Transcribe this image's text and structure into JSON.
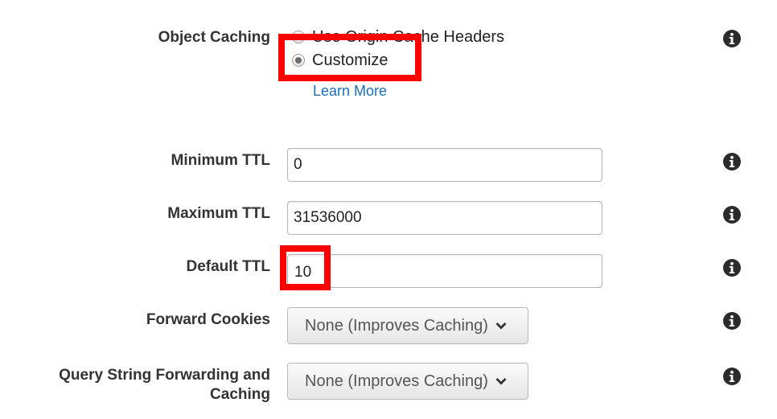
{
  "object_caching": {
    "label": "Object Caching",
    "options": [
      {
        "label": "Use Origin Cache Headers",
        "selected": false
      },
      {
        "label": "Customize",
        "selected": true
      }
    ],
    "learn_more": "Learn More",
    "info_icon": "info-circle-icon"
  },
  "minimum_ttl": {
    "label": "Minimum TTL",
    "value": "0",
    "info_icon": "info-circle-icon"
  },
  "maximum_ttl": {
    "label": "Maximum TTL",
    "value": "31536000",
    "info_icon": "info-circle-icon"
  },
  "default_ttl": {
    "label": "Default TTL",
    "value": "10",
    "info_icon": "info-circle-icon"
  },
  "forward_cookies": {
    "label": "Forward Cookies",
    "selected": "None (Improves Caching)",
    "info_icon": "info-circle-icon"
  },
  "query_string": {
    "label_line1": "Query String Forwarding and",
    "label_line2": "Caching",
    "selected": "None (Improves Caching)",
    "info_icon": "info-circle-icon"
  },
  "colors": {
    "highlight": "#ff0000",
    "link": "#1a6fb5",
    "label": "#333333",
    "icon": "#2b2b2b"
  }
}
